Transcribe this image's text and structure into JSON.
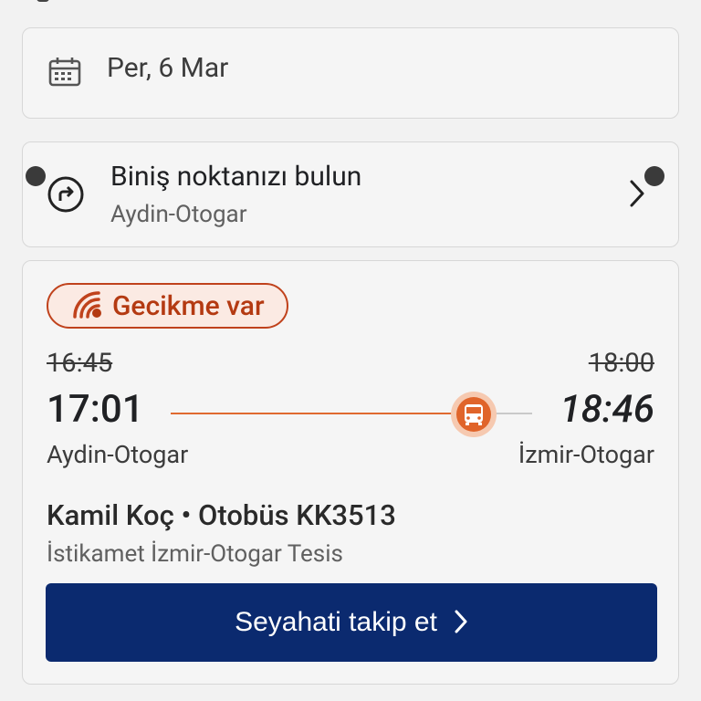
{
  "date_selector": {
    "value": "Per, 6 Mar",
    "icon": "calendar-icon"
  },
  "boarding_point": {
    "title": "Biniş noktanızı bulun",
    "subtitle": "Aydin-Otogar",
    "icon": "directions-icon"
  },
  "trip": {
    "delay_badge": "Gecikme var",
    "scheduled_departure": "16:45",
    "scheduled_arrival": "18:00",
    "actual_departure": "17:01",
    "estimated_arrival": "18:46",
    "origin": "Aydin-Otogar",
    "destination_stop": "İzmir-Otogar",
    "operator_line": "Kamil Koç • Otobüs KK3513",
    "direction": "İstikamet İzmir-Otogar Tesis",
    "progress": 0.85,
    "track_button": "Seyahati takip et"
  },
  "colors": {
    "primary_button": "#0b2a6f",
    "delay_accent": "#c0421c",
    "route_progress": "#e06a30"
  }
}
